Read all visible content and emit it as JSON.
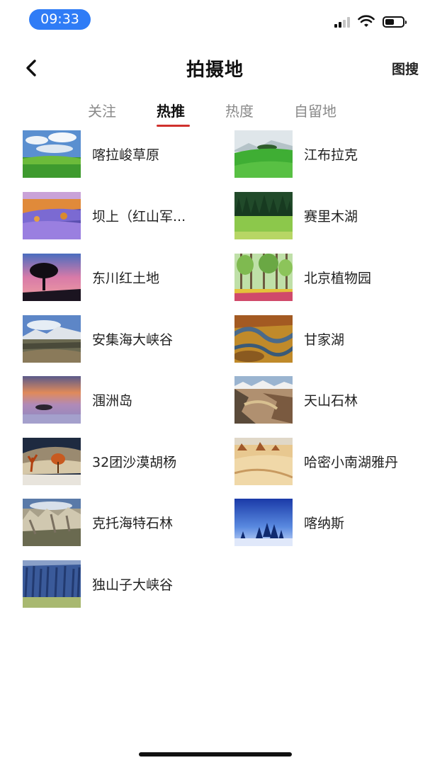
{
  "status_bar": {
    "time": "09:33"
  },
  "nav": {
    "title": "拍摄地",
    "action": "图搜"
  },
  "tabs": [
    {
      "label": "关注",
      "active": false
    },
    {
      "label": "热推",
      "active": true
    },
    {
      "label": "热度",
      "active": false
    },
    {
      "label": "自留地",
      "active": false
    }
  ],
  "colors": {
    "accent": "#d0312d",
    "time_pill": "#2f7cf6"
  },
  "locations": [
    {
      "name": "喀拉峻草原"
    },
    {
      "name": "江布拉克"
    },
    {
      "name": "坝上（红山军..."
    },
    {
      "name": "赛里木湖"
    },
    {
      "name": "东川红土地"
    },
    {
      "name": "北京植物园"
    },
    {
      "name": "安集海大峡谷"
    },
    {
      "name": "甘家湖"
    },
    {
      "name": "涠洲岛"
    },
    {
      "name": "天山石林"
    },
    {
      "name": "32团沙漠胡杨"
    },
    {
      "name": "哈密小南湖雅丹"
    },
    {
      "name": "克托海特石林"
    },
    {
      "name": "喀纳斯"
    },
    {
      "name": "独山子大峡谷"
    }
  ]
}
